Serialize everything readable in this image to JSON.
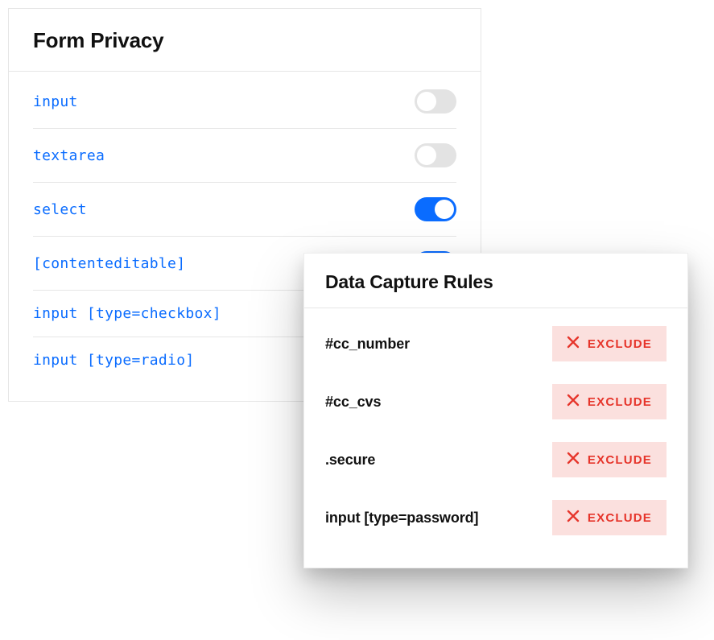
{
  "form_privacy": {
    "title": "Form Privacy",
    "rows": [
      {
        "selector": "input",
        "on": false
      },
      {
        "selector": "textarea",
        "on": false
      },
      {
        "selector": "select",
        "on": true
      },
      {
        "selector": "[contenteditable]",
        "on": true
      },
      {
        "selector": "input [type=checkbox]",
        "on": null
      },
      {
        "selector": "input [type=radio]",
        "on": null
      }
    ]
  },
  "data_capture_rules": {
    "title": "Data Capture Rules",
    "exclude_label": "EXCLUDE",
    "rules": [
      {
        "selector": "#cc_number"
      },
      {
        "selector": "#cc_cvs"
      },
      {
        "selector": ".secure"
      },
      {
        "selector": "input [type=password]"
      }
    ]
  },
  "colors": {
    "accent": "#0a6cff",
    "exclude_bg": "#fbe0de",
    "exclude_fg": "#e6352b"
  }
}
